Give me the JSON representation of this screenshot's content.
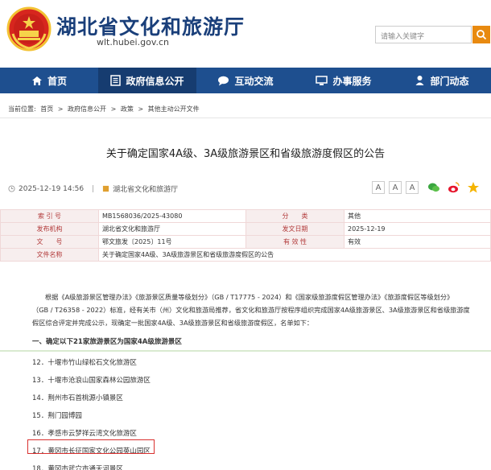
{
  "header": {
    "site_title": "湖北省文化和旅游厅",
    "site_domain": "wlt.hubei.gov.cn",
    "search_placeholder": "请输入关键字"
  },
  "nav": {
    "items": [
      {
        "label": "首页",
        "icon": "home-icon"
      },
      {
        "label": "政府信息公开",
        "icon": "document-icon"
      },
      {
        "label": "互动交流",
        "icon": "chat-icon"
      },
      {
        "label": "办事服务",
        "icon": "monitor-icon"
      },
      {
        "label": "部门动态",
        "icon": "person-icon"
      }
    ]
  },
  "breadcrumb": {
    "prefix": "当前位置:",
    "items": [
      "首页",
      "政府信息公开",
      "政策",
      "其他主动公开文件"
    ],
    "separator": ">"
  },
  "article": {
    "title": "关于确定国家4A级、3A级旅游景区和省级旅游度假区的公告",
    "date": "2025-12-19 14:56",
    "source": "湖北省文化和旅游厅",
    "font_sizes": [
      "A",
      "A",
      "A"
    ]
  },
  "info_table": {
    "rows": [
      {
        "l1": "索 引 号",
        "v1": "MB1568036/2025-43080",
        "l2": "分　　类",
        "v2": "其他"
      },
      {
        "l1": "发布机构",
        "v1": "湖北省文化和旅游厅",
        "l2": "发文日期",
        "v2": "2025-12-19"
      },
      {
        "l1": "文　　号",
        "v1": "鄂文旅发〔2025〕11号",
        "l2": "有 效 性",
        "v2": "有效"
      },
      {
        "l1": "文件名称",
        "v1": "关于确定国家4A级、3A级旅游景区和省级旅游度假区的公告",
        "l2": "",
        "v2": ""
      }
    ]
  },
  "body": {
    "paragraph_lines": [
      "根据《A级旅游景区管理办法》《旅游景区质量等级划分》（GB / T17775 - 2024）和《国家级旅游度假区管理办法》《旅游度假区等级划分》",
      "（GB / T26358 - 2022）标准，经有关市（州）文化和旅游局推荐，省文化和旅游厅按程序组织完成国家4A级旅游景区、3A级旅游景区和省级旅游度",
      "假区综合评定并完成公示，现确定一批国家4A级、3A级旅游景区和省级旅游度假区，名单如下："
    ],
    "section_heading": "一、确定以下21家旅游景区为国家4A级旅游景区",
    "list_items": [
      "12．十堰市竹山绿松石文化旅游区",
      "13．十堰市沧浪山国家森林公园旅游区",
      "14．荆州市石首桃源小镇景区",
      "15．荆门园博园",
      "16．孝感市云梦祥云湾文化旅游区",
      "17．黄冈市长征国家文化公园英山园区",
      "18．黄冈市武穴市通天河景区"
    ]
  },
  "colors": {
    "brand_blue": "#1e4f8f",
    "title_blue": "#1a3f7a",
    "search_orange": "#e88a10",
    "label_red": "#b23a3a",
    "highlight_red": "#d9302f"
  }
}
